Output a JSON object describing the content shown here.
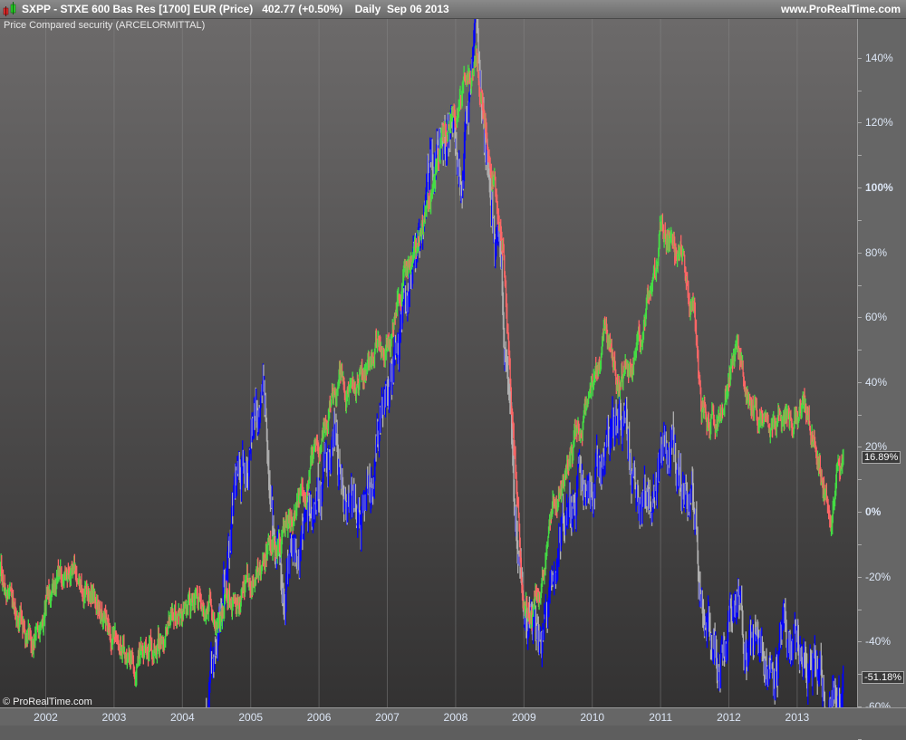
{
  "header": {
    "title": "SXPP - STXE 600 Bas Res [1700] EUR (Price)   402.77 (+0.50%)    Daily  Sep 06 2013",
    "site": "www.ProRealTime.com"
  },
  "subtitle": "Price Compared security (ARCELORMITTAL)",
  "copyright": "© ProRealTime.com",
  "colors": {
    "up": "#44dd44",
    "down": "#ff6666",
    "cmp_up": "#0000ff",
    "cmp_down": "#b0b0b0"
  },
  "chart_data": {
    "type": "bar",
    "title": "SXPP - STXE 600 Bas Res [1700] EUR (Price)",
    "ylim": [
      -62,
      152
    ],
    "xlim": [
      2001.33,
      2013.77
    ],
    "yticks": [
      {
        "v": 140,
        "label": "140%"
      },
      {
        "v": 120,
        "label": "120%"
      },
      {
        "v": 100,
        "label": "100%",
        "bold": true
      },
      {
        "v": 80,
        "label": "80%"
      },
      {
        "v": 60,
        "label": "60%"
      },
      {
        "v": 40,
        "label": "40%"
      },
      {
        "v": 20,
        "label": "20%"
      },
      {
        "v": 0,
        "label": "0%",
        "bold": true
      },
      {
        "v": -20,
        "label": "-20%"
      },
      {
        "v": -40,
        "label": "-40%"
      },
      {
        "v": -60,
        "label": "-60%"
      }
    ],
    "xticks": [
      "2002",
      "2003",
      "2004",
      "2005",
      "2006",
      "2007",
      "2008",
      "2009",
      "2010",
      "2011",
      "2012",
      "2013"
    ],
    "last_values": [
      {
        "v": 16.89,
        "label": "16.89%"
      },
      {
        "v": -51.18,
        "label": "-51.18%"
      }
    ],
    "series": [
      {
        "name": "SXPP",
        "anchors": [
          [
            2001.33,
            -20
          ],
          [
            2001.6,
            -30
          ],
          [
            2001.8,
            -40
          ],
          [
            2002.0,
            -27
          ],
          [
            2002.3,
            -20
          ],
          [
            2002.5,
            -17
          ],
          [
            2002.8,
            -30
          ],
          [
            2003.0,
            -40
          ],
          [
            2003.3,
            -48
          ],
          [
            2003.5,
            -45
          ],
          [
            2004.0,
            -30
          ],
          [
            2004.3,
            -25
          ],
          [
            2004.5,
            -32
          ],
          [
            2004.8,
            -25
          ],
          [
            2005.0,
            -22
          ],
          [
            2005.3,
            -10
          ],
          [
            2005.6,
            -5
          ],
          [
            2006.0,
            20
          ],
          [
            2006.3,
            45
          ],
          [
            2006.5,
            35
          ],
          [
            2006.8,
            50
          ],
          [
            2007.0,
            55
          ],
          [
            2007.3,
            75
          ],
          [
            2007.6,
            95
          ],
          [
            2007.8,
            115
          ],
          [
            2008.0,
            125
          ],
          [
            2008.3,
            140
          ],
          [
            2008.5,
            110
          ],
          [
            2008.7,
            80
          ],
          [
            2008.85,
            20
          ],
          [
            2009.0,
            -30
          ],
          [
            2009.2,
            -25
          ],
          [
            2009.5,
            5
          ],
          [
            2009.8,
            25
          ],
          [
            2010.0,
            35
          ],
          [
            2010.2,
            60
          ],
          [
            2010.4,
            40
          ],
          [
            2010.6,
            45
          ],
          [
            2010.9,
            70
          ],
          [
            2011.0,
            85
          ],
          [
            2011.3,
            75
          ],
          [
            2011.5,
            60
          ],
          [
            2011.6,
            30
          ],
          [
            2011.9,
            30
          ],
          [
            2012.1,
            50
          ],
          [
            2012.3,
            35
          ],
          [
            2012.6,
            25
          ],
          [
            2012.9,
            30
          ],
          [
            2013.1,
            35
          ],
          [
            2013.3,
            20
          ],
          [
            2013.5,
            0
          ],
          [
            2013.68,
            17
          ]
        ]
      },
      {
        "name": "ARCELORMITTAL",
        "anchors": [
          [
            2004.35,
            -62
          ],
          [
            2004.6,
            -25
          ],
          [
            2004.8,
            10
          ],
          [
            2005.0,
            25
          ],
          [
            2005.2,
            30
          ],
          [
            2005.3,
            -10
          ],
          [
            2005.5,
            -20
          ],
          [
            2005.8,
            -10
          ],
          [
            2006.0,
            5
          ],
          [
            2006.2,
            20
          ],
          [
            2006.4,
            10
          ],
          [
            2006.6,
            -5
          ],
          [
            2006.8,
            10
          ],
          [
            2007.0,
            35
          ],
          [
            2007.2,
            60
          ],
          [
            2007.5,
            80
          ],
          [
            2007.7,
            110
          ],
          [
            2007.9,
            120
          ],
          [
            2008.1,
            105
          ],
          [
            2008.3,
            150
          ],
          [
            2008.5,
            95
          ],
          [
            2008.7,
            60
          ],
          [
            2008.85,
            0
          ],
          [
            2009.0,
            -30
          ],
          [
            2009.2,
            -40
          ],
          [
            2009.4,
            -30
          ],
          [
            2009.6,
            0
          ],
          [
            2009.9,
            10
          ],
          [
            2010.2,
            20
          ],
          [
            2010.4,
            30
          ],
          [
            2010.6,
            5
          ],
          [
            2010.9,
            10
          ],
          [
            2011.0,
            20
          ],
          [
            2011.2,
            15
          ],
          [
            2011.5,
            0
          ],
          [
            2011.6,
            -25
          ],
          [
            2011.8,
            -45
          ],
          [
            2012.1,
            -28
          ],
          [
            2012.3,
            -40
          ],
          [
            2012.6,
            -45
          ],
          [
            2012.9,
            -42
          ],
          [
            2013.2,
            -50
          ],
          [
            2013.5,
            -60
          ],
          [
            2013.68,
            -51
          ]
        ]
      }
    ]
  }
}
